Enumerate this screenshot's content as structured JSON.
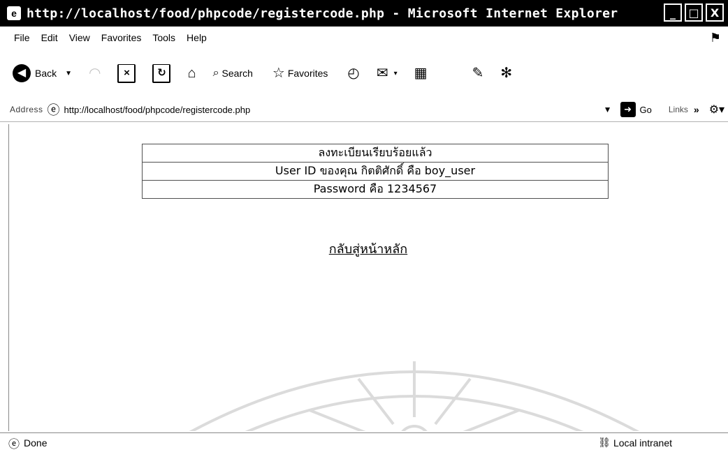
{
  "window": {
    "title": "http://localhost/food/phpcode/registercode.php - Microsoft Internet Explorer",
    "minimize_glyph": "_",
    "maximize_glyph": "□",
    "close_glyph": "X"
  },
  "menu": {
    "items": [
      "File",
      "Edit",
      "View",
      "Favorites",
      "Tools",
      "Help"
    ]
  },
  "toolbar": {
    "back_label": "Back",
    "search_label": "Search",
    "favorites_label": "Favorites"
  },
  "address": {
    "label": "Address",
    "url": "http://localhost/food/phpcode/registercode.php",
    "go_label": "Go",
    "links_label": "Links",
    "chevron": "»"
  },
  "page": {
    "rows": [
      "ลงทะเบียนเรียบร้อยแล้ว",
      "User ID ของคุณ กิตติศักดิ์ คือ boy_user",
      "Password คือ 1234567"
    ],
    "back_link": "กลับสู่หน้าหลัก"
  },
  "status": {
    "text": "Done",
    "zone": "Local intranet"
  },
  "icons": {
    "back": "back-arrow-icon",
    "forward": "forward-arrow-icon",
    "stop": "stop-icon",
    "refresh": "refresh-icon",
    "home": "home-icon",
    "search": "search-icon",
    "favorites": "favorites-star-icon",
    "history": "history-icon",
    "mail": "mail-icon",
    "print": "print-icon",
    "edit": "edit-icon",
    "messenger": "messenger-icon",
    "ie_page": "ie-page-icon",
    "go": "go-arrow-icon",
    "tools": "tools-icon"
  }
}
